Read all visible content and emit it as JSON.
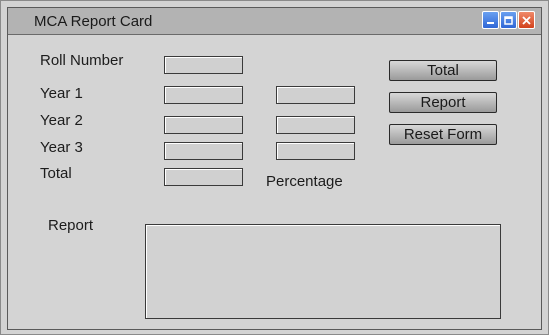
{
  "window": {
    "title": "MCA Report Card",
    "controls": [
      "minimize-icon",
      "maximize-icon",
      "close-icon"
    ]
  },
  "form": {
    "roll_number_label": "Roll Number",
    "year1_label": "Year 1",
    "year2_label": "Year 2",
    "year3_label": "Year 3",
    "total_label": "Total",
    "percentage_label": "Percentage",
    "report_label": "Report",
    "roll_number_value": "",
    "year1_value": "",
    "year2_value": "",
    "year3_value": "",
    "year1_percent": "",
    "year2_percent": "",
    "year3_percent": "",
    "total_value": "",
    "report_text": ""
  },
  "buttons": {
    "total": "Total",
    "report": "Report",
    "reset": "Reset Form"
  },
  "colors": {
    "window_bg": "#d4d4d4",
    "titlebar_bg": "#b3b3b3",
    "button_accent": "#2f66d6",
    "close_accent": "#d2421c"
  }
}
